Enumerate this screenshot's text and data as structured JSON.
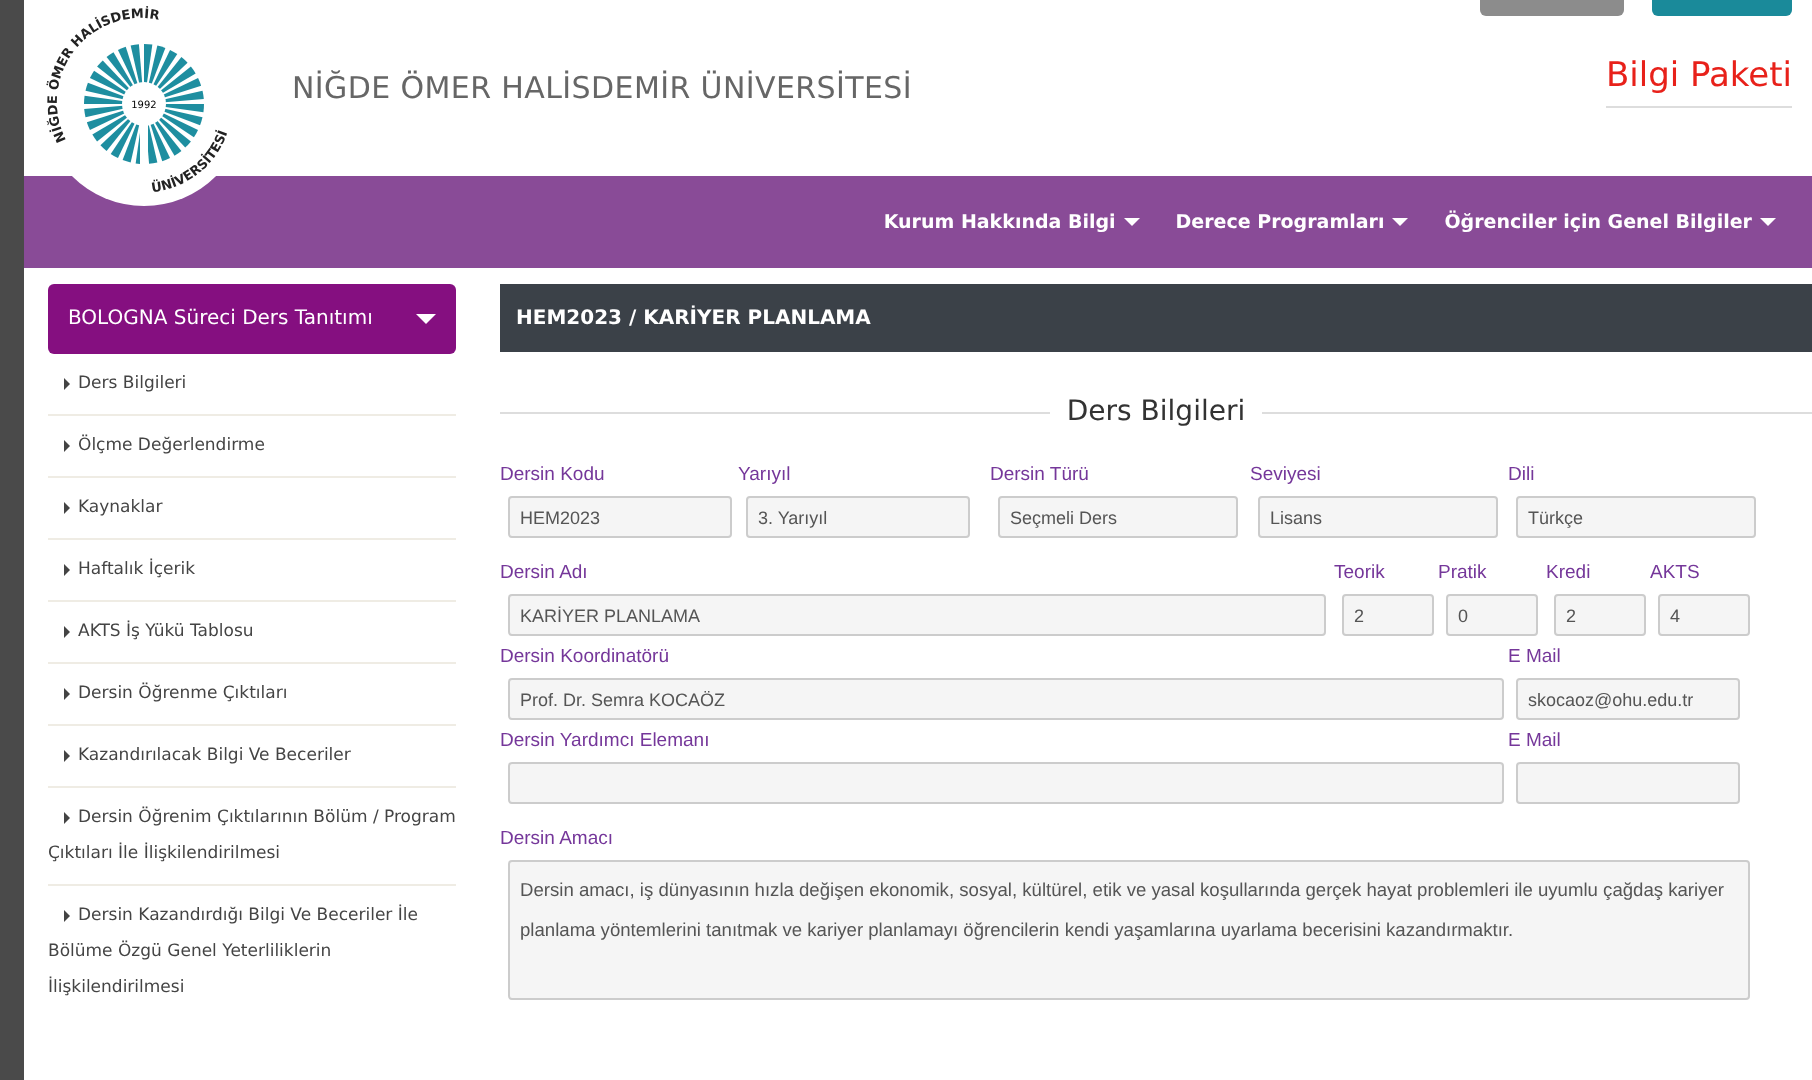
{
  "header": {
    "logo": {
      "top_text": "NİĞDE ÖMER HALİSDEMİR",
      "bottom_text": "ÜNİVERSİTESİ",
      "year": "1992"
    },
    "university_name": "NİĞDE ÖMER HALİSDEMİR ÜNİVERSİTESİ",
    "package_title": "Bilgi Paketi"
  },
  "nav": {
    "items": [
      "Kurum Hakkında Bilgi",
      "Derece Programları",
      "Öğrenciler için Genel Bilgiler"
    ]
  },
  "sidebar": {
    "title": "BOLOGNA Süreci Ders Tanıtımı",
    "items": [
      {
        "label": "Ders Bilgileri"
      },
      {
        "label": "Ölçme Değerlendirme"
      },
      {
        "label": "Kaynaklar"
      },
      {
        "label": "Haftalık İçerik"
      },
      {
        "label": "AKTS İş Yükü Tablosu"
      },
      {
        "label": "Dersin Öğrenme Çıktıları"
      },
      {
        "label": "Kazandırılacak Bilgi Ve Beceriler"
      },
      {
        "label": "Dersin Öğrenim Çıktılarının Bölüm / Program Çıktıları İle İlişkilendirilmesi"
      },
      {
        "label": "Dersin Kazandırdığı Bilgi Ve Beceriler İle Bölüme Özgü Genel Yeterliliklerin İlişkilendirilmesi"
      }
    ]
  },
  "panel": {
    "title": "HEM2023 / KARİYER PLANLAMA",
    "section_title": "Ders Bilgileri",
    "fields": [
      {
        "label": "Dersin Kodu",
        "value": "HEM2023",
        "kind": "input"
      },
      {
        "label": "Yarıyıl",
        "value": "3. Yarıyıl",
        "kind": "input"
      },
      {
        "label": "Dersin Türü",
        "value": "Seçmeli Ders",
        "kind": "input"
      },
      {
        "label": "Seviyesi",
        "value": "Lisans",
        "kind": "input"
      },
      {
        "label": "Dili",
        "value": "Türkçe",
        "kind": "input"
      },
      {
        "label": "Dersin Adı",
        "value": "KARİYER PLANLAMA",
        "kind": "input"
      },
      {
        "label": "Teorik",
        "value": "2",
        "kind": "input"
      },
      {
        "label": "Pratik",
        "value": "0",
        "kind": "input"
      },
      {
        "label": "Kredi",
        "value": "2",
        "kind": "input"
      },
      {
        "label": "AKTS",
        "value": "4",
        "kind": "input"
      },
      {
        "label": "Dersin Koordinatörü",
        "value": "Prof. Dr. Semra KOCAÖZ",
        "kind": "input"
      },
      {
        "label": "E Mail",
        "value": "skocaoz@ohu.edu.tr",
        "kind": "input"
      },
      {
        "label": "Dersin Yardımcı Elemanı",
        "kind": "input"
      },
      {
        "label": "E Mail",
        "kind": "input"
      },
      {
        "label": "Dersin Amacı",
        "value": "Dersin amacı, iş dünyasının hızla değişen ekonomik, sosyal, kültürel, etik ve yasal koşullarında gerçek hayat problemleri ile uyumlu çağdaş kariyer planlama yöntemlerini tanıtmak ve kariyer planlamayı öğrencilerin kendi yaşamlarına uyarlama becerisini kazandırmaktır.",
        "kind": "textarea"
      }
    ]
  }
}
